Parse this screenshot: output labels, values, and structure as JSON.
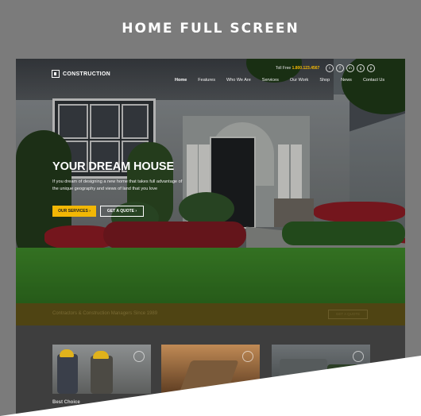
{
  "page": {
    "title": "HOME FULL SCREEN"
  },
  "site": {
    "brand": "CONSTRUCTION",
    "tollfree_label": "Toll Free",
    "phone": "1.800.123.4567",
    "social": [
      "t",
      "f",
      "in",
      "g",
      "p"
    ],
    "nav": [
      "Home",
      "Features",
      "Who We Are",
      "Services",
      "Our Work",
      "Shop",
      "News",
      "Contact Us"
    ],
    "hero": {
      "title": "YOUR DREAM HOUSE",
      "text": "If you dream of designing a new home that takes full advantage of the unique geography and views of land that you love",
      "primary_button": "OUR SERVICES ›",
      "secondary_button": "GET A QUOTE ›"
    },
    "banner": {
      "text": "Contractors & Construction Managers Since 1989",
      "button": "GET A QUOTE"
    },
    "services": {
      "first_title": "Best Choice"
    }
  },
  "colors": {
    "accent": "#f2b705",
    "background": "#7b7b7b"
  }
}
